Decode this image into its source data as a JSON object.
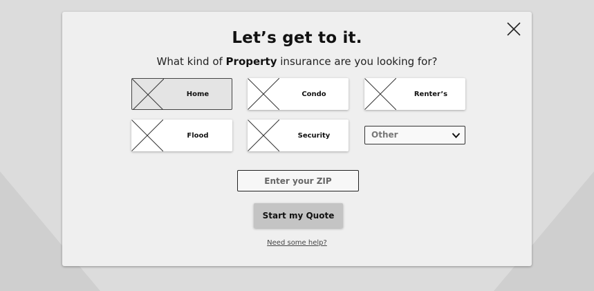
{
  "modal": {
    "title": "Let’s get to it.",
    "subtitle_prefix": "What kind of ",
    "subtitle_emphasis": "Property",
    "subtitle_suffix": " insurance are you looking for?",
    "close_icon": "close-icon"
  },
  "options": [
    {
      "label": "Home",
      "selected": true,
      "icon": "placeholder-image-icon"
    },
    {
      "label": "Condo",
      "selected": false,
      "icon": "placeholder-image-icon"
    },
    {
      "label": "Renter’s",
      "selected": false,
      "icon": "placeholder-image-icon"
    },
    {
      "label": "Flood",
      "selected": false,
      "icon": "placeholder-image-icon"
    },
    {
      "label": "Security",
      "selected": false,
      "icon": "placeholder-image-icon"
    }
  ],
  "other_select": {
    "value": "Other",
    "icon": "chevron-down-icon"
  },
  "zip": {
    "placeholder": "Enter your ZIP",
    "value": ""
  },
  "cta": {
    "label": "Start my Quote"
  },
  "help": {
    "label": "Need some help?"
  },
  "colors": {
    "page_background": "#dcdcdc",
    "modal_background": "#efefef",
    "selected_option": "#e4e4e4",
    "cta_background": "#c4c4c4"
  }
}
